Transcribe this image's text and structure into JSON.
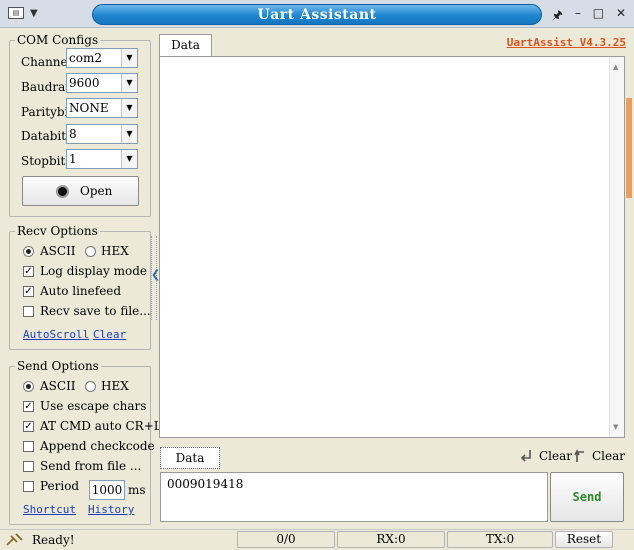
{
  "window": {
    "title": "Uart Assistant",
    "controls": {
      "pin": "🖈",
      "minimize": "–",
      "maximize": "□",
      "close": "✕"
    }
  },
  "com_configs": {
    "legend": "COM Configs",
    "fields": [
      {
        "label": "Channel",
        "value": "com2"
      },
      {
        "label": "Baudrate",
        "value": "9600"
      },
      {
        "label": "Paritybits",
        "value": "NONE"
      },
      {
        "label": "Databits",
        "value": "8"
      },
      {
        "label": "Stopbits",
        "value": "1"
      }
    ],
    "open_button": "Open"
  },
  "recv_options": {
    "legend": "Recv Options",
    "ascii": "ASCII",
    "hex": "HEX",
    "log_display": "Log display mode",
    "auto_linefeed": "Auto linefeed",
    "save_to_file": "Recv save to file...",
    "autoscroll": "AutoScroll",
    "clear": "Clear",
    "checked": {
      "ascii": true,
      "log_display": true,
      "auto_linefeed": true,
      "save_to_file": false
    }
  },
  "send_options": {
    "legend": "Send Options",
    "ascii": "ASCII",
    "hex": "HEX",
    "escape": "Use escape chars",
    "at_cmd": "AT CMD auto CR+L",
    "checkcode": "Append checkcode",
    "from_file": "Send from file ...",
    "period": "Period",
    "period_value": "1000",
    "period_unit": "ms",
    "shortcut": "Shortcut",
    "history": "History",
    "checked": {
      "ascii": true,
      "escape": true,
      "at_cmd": true,
      "checkcode": false,
      "from_file": false,
      "period": false
    }
  },
  "log": {
    "tab": "Data log",
    "version": "UartAssist V4.3.25",
    "content": ""
  },
  "send": {
    "tab": "Data Send",
    "clear1": "Clear",
    "clear2": "Clear",
    "input": "0009019418",
    "send_button": "Send"
  },
  "status": {
    "ready": "Ready!",
    "counter": "0/0",
    "rx": "RX:0",
    "tx": "TX:0",
    "reset": "Reset"
  },
  "colors": {
    "title_accent": "#1f86cf",
    "version": "#e0521e",
    "send_button": "#2d8a2d",
    "link": "#1a3dbf"
  }
}
